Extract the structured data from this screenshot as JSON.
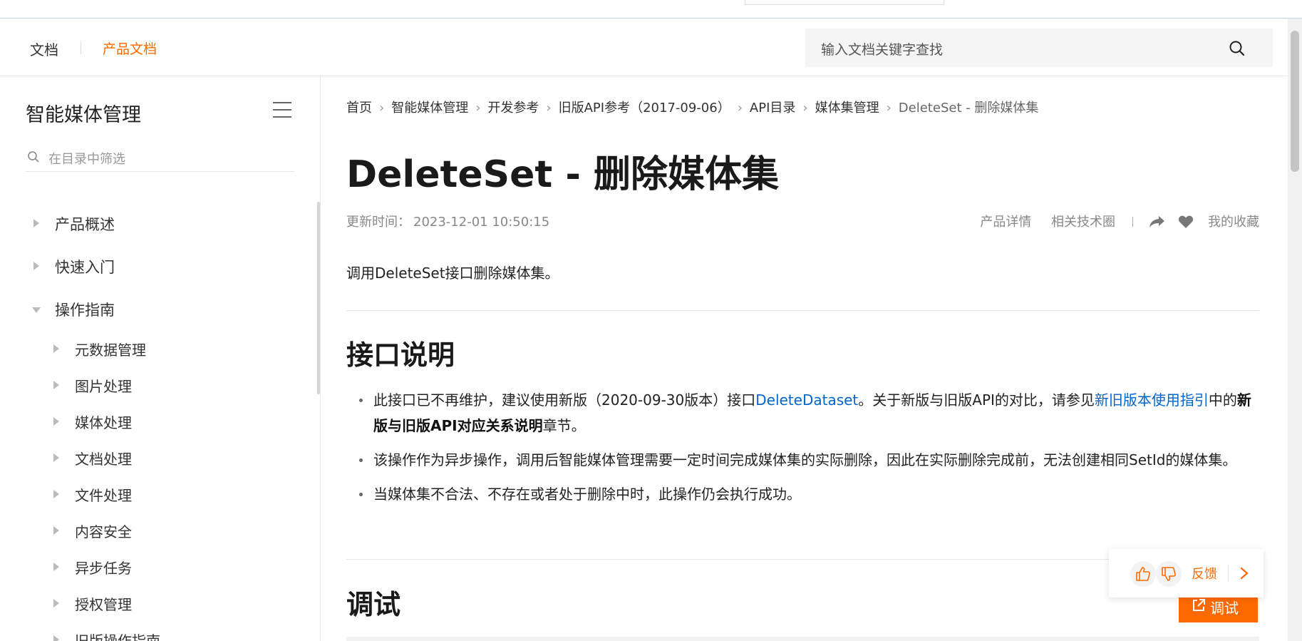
{
  "header": {
    "docs_label": "文档",
    "product_docs_label": "产品文档",
    "search_placeholder": "输入文档关键字查找"
  },
  "sidebar": {
    "title": "智能媒体管理",
    "filter_placeholder": "在目录中筛选",
    "items": [
      {
        "label": "产品概述",
        "level": 1,
        "expanded": false
      },
      {
        "label": "快速入门",
        "level": 1,
        "expanded": false
      },
      {
        "label": "操作指南",
        "level": 1,
        "expanded": true
      },
      {
        "label": "元数据管理",
        "level": 2,
        "expanded": false
      },
      {
        "label": "图片处理",
        "level": 2,
        "expanded": false
      },
      {
        "label": "媒体处理",
        "level": 2,
        "expanded": false
      },
      {
        "label": "文档处理",
        "level": 2,
        "expanded": false
      },
      {
        "label": "文件处理",
        "level": 2,
        "expanded": false
      },
      {
        "label": "内容安全",
        "level": 2,
        "expanded": false
      },
      {
        "label": "异步任务",
        "level": 2,
        "expanded": false
      },
      {
        "label": "授权管理",
        "level": 2,
        "expanded": false
      },
      {
        "label": "旧版操作指南",
        "level": 2,
        "expanded": false
      }
    ]
  },
  "breadcrumb": [
    "首页",
    "智能媒体管理",
    "开发参考",
    "旧版API参考（2017-09-06）",
    "API目录",
    "媒体集管理",
    "DeleteSet - 删除媒体集"
  ],
  "article": {
    "title": "DeleteSet - 删除媒体集",
    "updated_label": "更新时间：",
    "updated_value": "2023-12-01 10:50:15",
    "meta_product_detail": "产品详情",
    "meta_tech_circle": "相关技术圈",
    "meta_favorites": "我的收藏",
    "intro": "调用DeleteSet接口删除媒体集。",
    "section1_title": "接口说明",
    "bullet1_a": "此接口已不再维护，建议使用新版（2020-09-30版本）接口",
    "bullet1_link1": "DeleteDataset",
    "bullet1_b": "。关于新版与旧版API的对比，请参见",
    "bullet1_link2": "新旧版本使用指引",
    "bullet1_c": "中的",
    "bullet1_bold": "新版与旧版API对应关系说明",
    "bullet1_d": "章节。",
    "bullet2": "该操作作为异步操作，调用后智能媒体管理需要一定时间完成媒体集的实际删除，因此在实际删除完成前，无法创建相同SetId的媒体集。",
    "bullet3": "当媒体集不合法、不存在或者处于删除中时，此操作仍会执行成功。",
    "section2_title": "调试"
  },
  "widgets": {
    "feedback_label": "反馈",
    "debug_label": "调试"
  },
  "colors": {
    "accent": "#ff6a00",
    "link": "#0066cc"
  }
}
